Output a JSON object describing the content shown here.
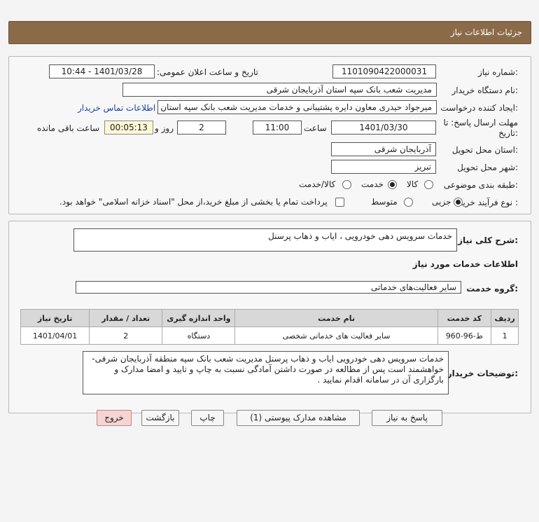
{
  "header": {
    "title": "جزئیات اطلاعات نیاز"
  },
  "form": {
    "need_number_label": "شماره نیاز:",
    "need_number": "1101090422000031",
    "announce_label": "تاریخ و ساعت اعلان عمومی:",
    "announce_value": "1401/03/28 - 10:44",
    "buyer_org_label": "نام دستگاه خریدار:",
    "buyer_org": "مدیریت شعب بانک سپه استان آذربایجان شرقی",
    "creator_label": "ایجاد کننده درخواست:",
    "creator": "میرجواد حیدری معاون دایره پشتیبانی و خدمات مدیریت شعب بانک سپه استان",
    "contact_link": "اطلاعات تماس خریدار",
    "deadline_label_1": "مهلت ارسال پاسخ: تا",
    "deadline_label_2": "تاریخ:",
    "deadline_date": "1401/03/30",
    "time_label": "ساعت",
    "deadline_time": "11:00",
    "days_value": "2",
    "days_label": "روز و",
    "remaining_value": "00:05:13",
    "remaining_label": "ساعت باقی مانده",
    "province_label": "استان محل تحویل:",
    "province": "آذربایجان شرقی",
    "city_label": "شهر محل تحویل:",
    "city": "تبریز",
    "category_label": "طبقه بندی موضوعی:",
    "category_options": [
      "کالا",
      "خدمت",
      "کالا/خدمت"
    ],
    "category_selected": "خدمت",
    "process_label": "نوع فرآیند خرید :",
    "process_options": [
      "جزیی",
      "متوسط"
    ],
    "process_selected": "جزیی",
    "treasury_note": "پرداخت تمام یا بخشی از مبلغ خرید،از محل \"اسناد خزانه اسلامی\" خواهد بود."
  },
  "details": {
    "summary_label": "شرح کلی نیاز:",
    "summary": "خدمات سرویس دهی خودرویی ، ایاب و ذهاب پرسنل",
    "services_heading": "اطلاعات خدمات مورد نیاز",
    "service_group_label": "گروه خدمت:",
    "service_group": "سایر فعالیت‌های خدماتی",
    "table": {
      "headers": [
        "ردیف",
        "کد خدمت",
        "نام خدمت",
        "واحد اندازه گیری",
        "تعداد / مقدار",
        "تاریخ نیاز"
      ],
      "rows": [
        [
          "1",
          "ط-96-960",
          "سایر فعالیت های خدماتی شخصی",
          "دستگاه",
          "2",
          "1401/04/01"
        ]
      ]
    },
    "buyer_notes_label": "توضیحات خریدار:",
    "buyer_notes": "خدمات سرویس دهی خودرویی ایاب و ذهاب پرسنل مدیریت شعب بانک سپه منطقه آذربایجان شرقی-خواهشمند است پس از مطالعه در صورت داشتن آمادگی نسبت به چاپ و تایید و امضا مدارک و بارگزاری آن در سامانه اقدام نمایید ."
  },
  "buttons": {
    "reply": "پاسخ به نیاز",
    "attachments": "مشاهده مدارک پیوستی (1)",
    "print": "چاپ",
    "back": "بازگشت",
    "exit": "خروج"
  },
  "colors": {
    "header_bg": "#8a6a48",
    "exit_bg": "#f7d3d3"
  }
}
